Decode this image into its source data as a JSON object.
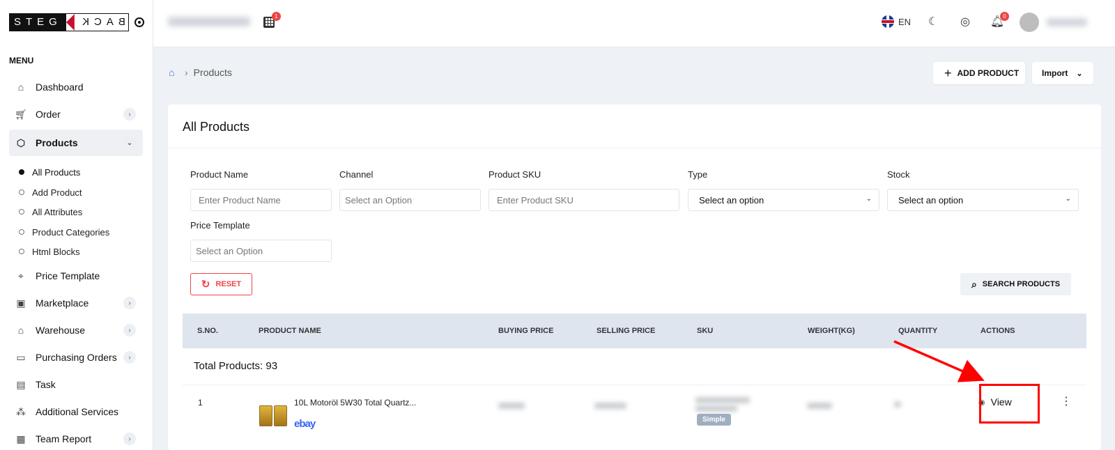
{
  "brand": {
    "left": "STEG",
    "right": "BACK"
  },
  "sidebar": {
    "menu_title": "MENU",
    "items": [
      {
        "label": "Dashboard",
        "icon": "home-icon",
        "has_chevron": false
      },
      {
        "label": "Order",
        "icon": "cart-icon",
        "has_chevron": true
      },
      {
        "label": "Products",
        "icon": "box-icon",
        "has_chevron": true,
        "active": true
      },
      {
        "label": "Price Template",
        "icon": "tag-icon",
        "has_chevron": false
      },
      {
        "label": "Marketplace",
        "icon": "shopping-bag-icon",
        "has_chevron": true
      },
      {
        "label": "Warehouse",
        "icon": "warehouse-icon",
        "has_chevron": true
      },
      {
        "label": "Purchasing Orders",
        "icon": "ticket-icon",
        "has_chevron": true
      },
      {
        "label": "Task",
        "icon": "clipboard-icon",
        "has_chevron": false
      },
      {
        "label": "Additional Services",
        "icon": "network-icon",
        "has_chevron": false
      },
      {
        "label": "Team Report",
        "icon": "report-icon",
        "has_chevron": true
      }
    ],
    "sub_items": [
      {
        "label": "All Products",
        "active": true
      },
      {
        "label": "Add Product"
      },
      {
        "label": "All Attributes"
      },
      {
        "label": "Product Categories"
      },
      {
        "label": "Html Blocks"
      }
    ]
  },
  "topbar": {
    "grid_badge": "1",
    "language": "EN",
    "notification_badge": "0"
  },
  "breadcrumb": {
    "current": "Products"
  },
  "actions": {
    "add_product": "ADD PRODUCT",
    "import": "Import"
  },
  "card": {
    "title": "All Products",
    "filters": {
      "product_name_label": "Product Name",
      "product_name_placeholder": "Enter Product Name",
      "channel_label": "Channel",
      "channel_placeholder": "Select an Option",
      "sku_label": "Product SKU",
      "sku_placeholder": "Enter Product SKU",
      "type_label": "Type",
      "type_value": "Select an option",
      "stock_label": "Stock",
      "stock_value": "Select an option",
      "price_template_label": "Price Template",
      "price_template_placeholder": "Select an Option"
    },
    "reset": "RESET",
    "search": "SEARCH PRODUCTS",
    "table": {
      "headers": [
        "S.NO.",
        "PRODUCT NAME",
        "BUYING PRICE",
        "SELLING PRICE",
        "SKU",
        "WEIGHT(KG)",
        "QUANTITY",
        "ACTIONS"
      ],
      "total": "Total Products: 93",
      "rows": [
        {
          "sno": "1",
          "name": "10L Motoröl 5W30 Total Quartz...",
          "channel": "ebay",
          "type_tag": "Simple",
          "action": "View"
        }
      ]
    }
  },
  "colors": {
    "accent": "#3b6fd8",
    "danger": "#ef4444",
    "annotation": "#ff0000"
  }
}
